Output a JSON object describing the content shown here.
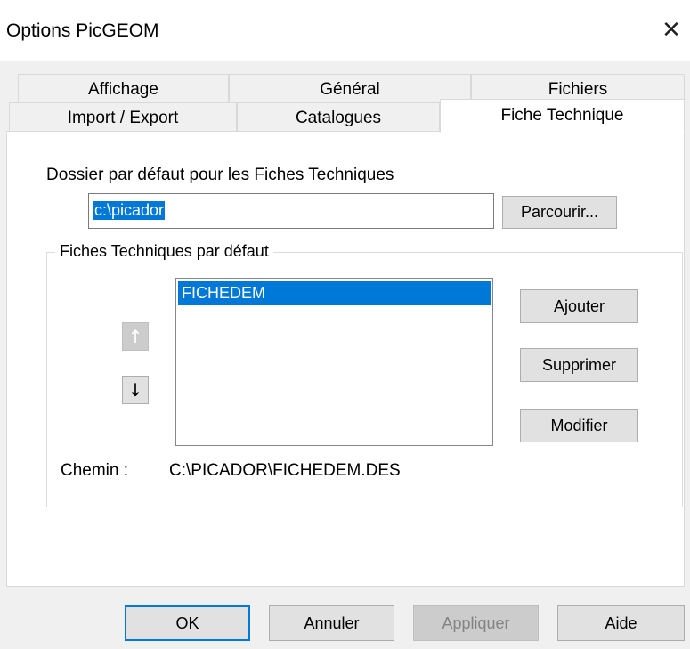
{
  "window": {
    "title": "Options PicGEOM",
    "close_glyph": "✕"
  },
  "tabs_row1": [
    {
      "label": "Affichage"
    },
    {
      "label": "Général"
    },
    {
      "label": "Fichiers"
    }
  ],
  "tabs_row2": [
    {
      "label": "Import / Export"
    },
    {
      "label": "Catalogues"
    },
    {
      "label": "Fiche Technique",
      "active": true
    }
  ],
  "panel": {
    "folder_label": "Dossier par défaut pour les Fiches Techniques",
    "folder_value": "c:\\picador",
    "browse_button": "Parcourir...",
    "group_title": "Fiches Techniques par défaut",
    "list_items": [
      {
        "label": "FICHEDEM",
        "selected": true
      }
    ],
    "move_up_glyph": "↑",
    "move_down_glyph": "↓",
    "add_button": "Ajouter",
    "delete_button": "Supprimer",
    "modify_button": "Modifier",
    "path_label": "Chemin :",
    "path_value": "C:\\PICADOR\\FICHEDEM.DES"
  },
  "footer": {
    "ok": "OK",
    "cancel": "Annuler",
    "apply": "Appliquer",
    "help": "Aide"
  },
  "colors": {
    "selection": "#0078d7",
    "dialog_bg": "#f0f0f0"
  },
  "icons": {
    "close": "close-icon",
    "up": "arrow-up-icon",
    "down": "arrow-down-icon"
  }
}
